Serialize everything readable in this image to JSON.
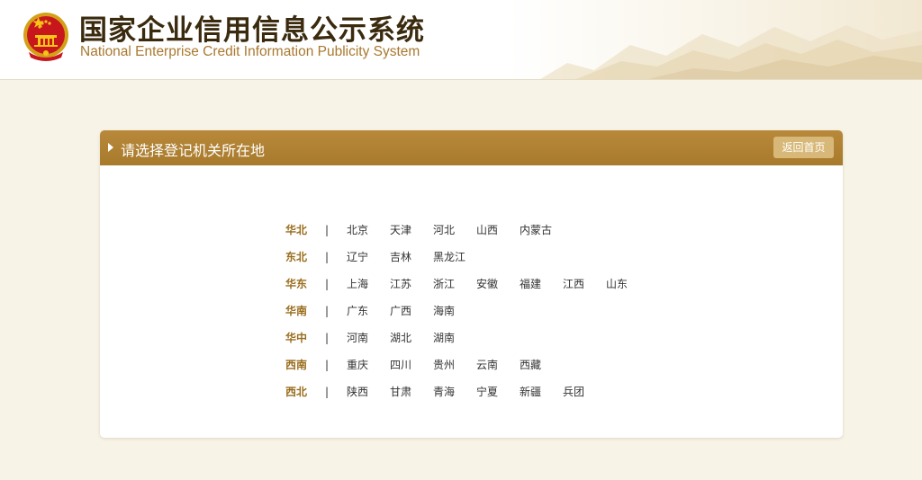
{
  "header": {
    "title_cn": "国家企业信用信息公示系统",
    "title_en": "National Enterprise Credit Information Publicity System",
    "logo_icon": "national-emblem-icon"
  },
  "panel": {
    "title": "请选择登记机关所在地",
    "back_button": "返回首页"
  },
  "separator": "|",
  "regions": [
    {
      "name": "华北",
      "provinces": [
        "北京",
        "天津",
        "河北",
        "山西",
        "内蒙古"
      ]
    },
    {
      "name": "东北",
      "provinces": [
        "辽宁",
        "吉林",
        "黑龙江"
      ]
    },
    {
      "name": "华东",
      "provinces": [
        "上海",
        "江苏",
        "浙江",
        "安徽",
        "福建",
        "江西",
        "山东"
      ]
    },
    {
      "name": "华南",
      "provinces": [
        "广东",
        "广西",
        "海南"
      ]
    },
    {
      "name": "华中",
      "provinces": [
        "河南",
        "湖北",
        "湖南"
      ]
    },
    {
      "name": "西南",
      "provinces": [
        "重庆",
        "四川",
        "贵州",
        "云南",
        "西藏"
      ]
    },
    {
      "name": "西北",
      "provinces": [
        "陕西",
        "甘肃",
        "青海",
        "宁夏",
        "新疆",
        "兵团"
      ]
    }
  ],
  "colors": {
    "accent": "#a87a2c",
    "region_label": "#9a6d1e",
    "button": "#d8b878",
    "background": "#f7f3e6"
  }
}
